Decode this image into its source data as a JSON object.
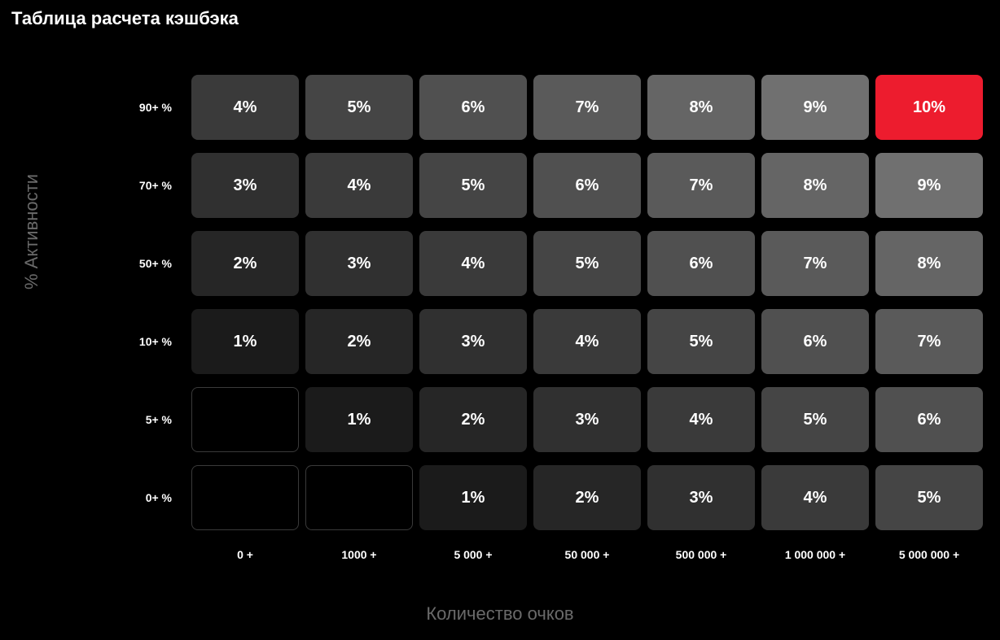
{
  "title": "Таблица расчета кэшбэка",
  "y_axis_label": "% Активности",
  "x_axis_label": "Количество очков",
  "row_labels": [
    "90+ %",
    "70+ %",
    "50+ %",
    "10+ %",
    "5+ %",
    "0+ %"
  ],
  "col_labels": [
    "0 +",
    "1000 +",
    "5 000 +",
    "50 000 +",
    "500 000 +",
    "1 000 000 +",
    "5 000 000 +"
  ],
  "grid": [
    [
      "4%",
      "5%",
      "6%",
      "7%",
      "8%",
      "9%",
      "10%"
    ],
    [
      "3%",
      "4%",
      "5%",
      "6%",
      "7%",
      "8%",
      "9%"
    ],
    [
      "2%",
      "3%",
      "4%",
      "5%",
      "6%",
      "7%",
      "8%"
    ],
    [
      "1%",
      "2%",
      "3%",
      "4%",
      "5%",
      "6%",
      "7%"
    ],
    [
      "",
      "1%",
      "2%",
      "3%",
      "4%",
      "5%",
      "6%"
    ],
    [
      "",
      "",
      "1%",
      "2%",
      "3%",
      "4%",
      "5%"
    ]
  ],
  "grid_values": [
    [
      4,
      5,
      6,
      7,
      8,
      9,
      10
    ],
    [
      3,
      4,
      5,
      6,
      7,
      8,
      9
    ],
    [
      2,
      3,
      4,
      5,
      6,
      7,
      8
    ],
    [
      1,
      2,
      3,
      4,
      5,
      6,
      7
    ],
    [
      0,
      1,
      2,
      3,
      4,
      5,
      6
    ],
    [
      0,
      0,
      1,
      2,
      3,
      4,
      5
    ]
  ],
  "chart_data": {
    "type": "heatmap",
    "title": "Таблица расчета кэшбэка",
    "xlabel": "Количество очков",
    "ylabel": "% Активности",
    "x_categories": [
      "0 +",
      "1000 +",
      "5 000 +",
      "50 000 +",
      "500 000 +",
      "1 000 000 +",
      "5 000 000 +"
    ],
    "y_categories": [
      "90+ %",
      "70+ %",
      "50+ %",
      "10+ %",
      "5+ %",
      "0+ %"
    ],
    "values": [
      [
        4,
        5,
        6,
        7,
        8,
        9,
        10
      ],
      [
        3,
        4,
        5,
        6,
        7,
        8,
        9
      ],
      [
        2,
        3,
        4,
        5,
        6,
        7,
        8
      ],
      [
        1,
        2,
        3,
        4,
        5,
        6,
        7
      ],
      [
        null,
        1,
        2,
        3,
        4,
        5,
        6
      ],
      [
        null,
        null,
        1,
        2,
        3,
        4,
        5
      ]
    ],
    "value_suffix": "%",
    "highlight": {
      "row": 0,
      "col": 6,
      "color": "#ed1c2e"
    }
  }
}
